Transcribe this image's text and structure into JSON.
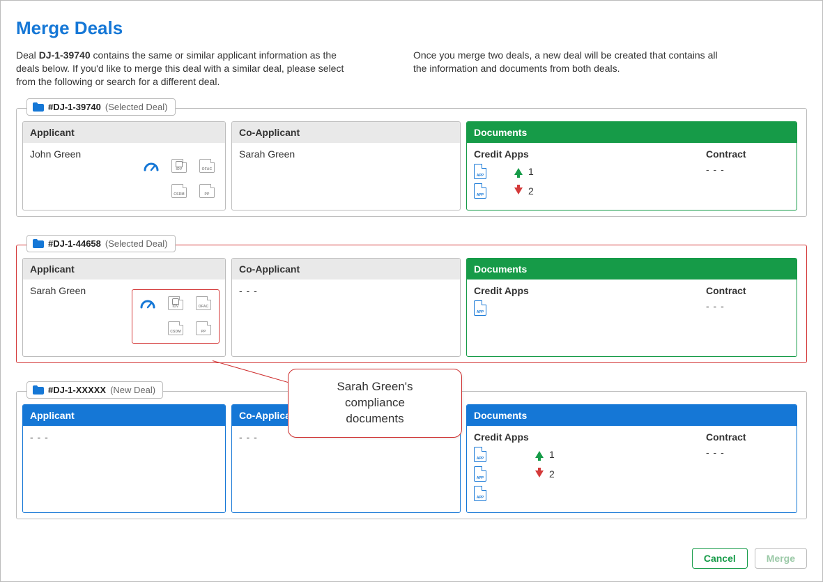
{
  "title": "Merge Deals",
  "intro": {
    "deal_id": "DJ-1-39740",
    "left_before": "Deal ",
    "left_after": " contains the same or similar applicant information as the deals below. If you'd like to merge this deal with a similar deal, please select from the following or search for a different deal.",
    "right": "Once you merge two deals, a new deal will be created that contains all the information and documents from both deals."
  },
  "labels": {
    "applicant": "Applicant",
    "coapplicant": "Co-Applicant",
    "documents": "Documents",
    "credit_apps": "Credit Apps",
    "contract": "Contract"
  },
  "icons": {
    "idv": "IDV",
    "ofac": "OFAC",
    "csdm": "CSDM",
    "pp": "PP"
  },
  "deals": [
    {
      "id": "#DJ-1-39740",
      "note": "(Selected Deal)",
      "folder_color": "#1577d6",
      "style": "grey",
      "docs_head": "green",
      "selected": false,
      "applicant": "John Green",
      "coapplicant": "Sarah Green",
      "credit_rows": [
        {
          "arrow": "up",
          "num": "1"
        },
        {
          "arrow": "down",
          "num": "2"
        }
      ],
      "contract": "- - -"
    },
    {
      "id": "#DJ-1-44658",
      "note": "(Selected Deal)",
      "folder_color": "#1577d6",
      "style": "grey",
      "docs_head": "green",
      "selected": true,
      "applicant": "Sarah Green",
      "coapplicant": "- - -",
      "credit_rows": [
        {
          "arrow": "",
          "num": ""
        }
      ],
      "contract": "- - -"
    },
    {
      "id": "#DJ-1-XXXXX",
      "note": "(New Deal)",
      "folder_color": "#1577d6",
      "style": "blue",
      "docs_head": "blue",
      "selected": false,
      "applicant": "- - -",
      "coapplicant": "- - -",
      "credit_rows": [
        {
          "arrow": "up",
          "num": "1",
          "gap": "tight"
        },
        {
          "arrow": "down",
          "num": "2",
          "gap": "tight"
        },
        {
          "arrow": "",
          "num": ""
        }
      ],
      "contract": "- - -"
    }
  ],
  "callout": {
    "line1": "Sarah Green's compliance",
    "line2": "documents"
  },
  "buttons": {
    "cancel": "Cancel",
    "merge": "Merge"
  }
}
